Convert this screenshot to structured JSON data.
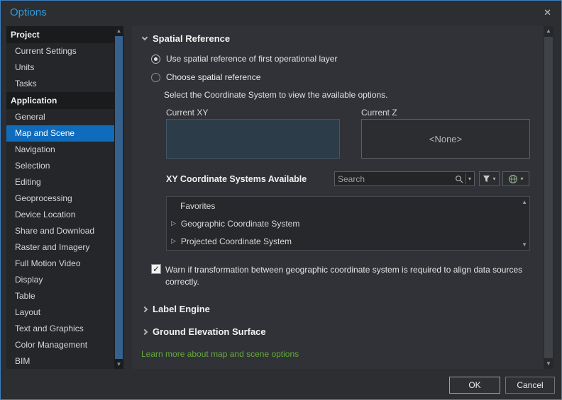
{
  "window": {
    "title": "Options"
  },
  "icons": {
    "close": "✕",
    "scroll_up": "▲",
    "scroll_down": "▼",
    "dropdown": "▾",
    "expand_triangle": "▷",
    "check": "✓"
  },
  "colors": {
    "accent_blue": "#0f6cbd",
    "title_blue": "#2f9bd8",
    "link_green": "#64aa3c"
  },
  "sidebar": {
    "sections": [
      {
        "header": "Project",
        "items": [
          "Current Settings",
          "Units",
          "Tasks"
        ]
      },
      {
        "header": "Application",
        "items": [
          "General",
          "Map and Scene",
          "Navigation",
          "Selection",
          "Editing",
          "Geoprocessing",
          "Device Location",
          "Share and Download",
          "Raster and Imagery",
          "Full Motion Video",
          "Display",
          "Table",
          "Layout",
          "Text and Graphics",
          "Color Management",
          "BIM"
        ]
      }
    ],
    "selected_item": "Map and Scene"
  },
  "main": {
    "spatial_reference": {
      "title": "Spatial Reference",
      "radio_first_layer_label": "Use spatial reference of first operational layer",
      "radio_choose_label": "Choose spatial reference",
      "hint": "Select the Coordinate System to view the available options.",
      "current_xy_label": "Current XY",
      "current_z_label": "Current Z",
      "current_z_value": "<None>",
      "xy_systems_heading": "XY Coordinate Systems Available",
      "search_placeholder": "Search",
      "list_items": [
        "Favorites",
        "Geographic Coordinate System",
        "Projected Coordinate System"
      ],
      "warn_label": "Warn if transformation between geographic coordinate system is required to align data sources correctly."
    },
    "label_engine": {
      "title": "Label Engine"
    },
    "ground_elevation": {
      "title": "Ground Elevation Surface"
    },
    "learn_more_link": "Learn more about map and scene options"
  },
  "footer": {
    "ok_label": "OK",
    "cancel_label": "Cancel"
  }
}
